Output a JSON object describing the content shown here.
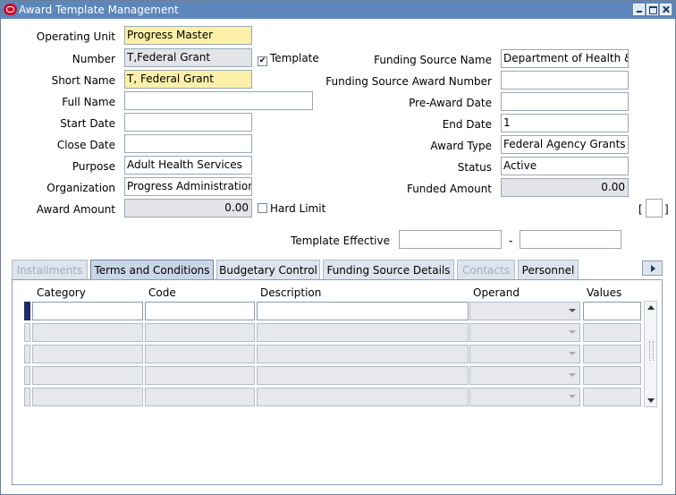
{
  "window": {
    "title": "Award Template Management"
  },
  "left": {
    "operating_unit": {
      "label": "Operating Unit",
      "value": "Progress Master"
    },
    "number": {
      "label": "Number",
      "value": "T,Federal Grant"
    },
    "template_checkbox": {
      "label": "Template",
      "checked_mark": "✔"
    },
    "short_name": {
      "label": "Short Name",
      "value": "T, Federal Grant"
    },
    "full_name": {
      "label": "Full Name",
      "value": ""
    },
    "start_date": {
      "label": "Start Date",
      "value": ""
    },
    "close_date": {
      "label": "Close Date",
      "value": ""
    },
    "purpose": {
      "label": "Purpose",
      "value": "Adult Health Services"
    },
    "organization": {
      "label": "Organization",
      "value": "Progress Administration"
    },
    "award_amount": {
      "label": "Award Amount",
      "value": "0.00"
    },
    "hard_limit": {
      "label": "Hard Limit"
    }
  },
  "right": {
    "funding_source_name": {
      "label": "Funding Source Name",
      "value": "Department of Health &"
    },
    "funding_source_award_number": {
      "label": "Funding Source Award Number",
      "value": ""
    },
    "pre_award_date": {
      "label": "Pre-Award Date",
      "value": ""
    },
    "end_date": {
      "label": "End Date",
      "value": "1"
    },
    "award_type": {
      "label": "Award Type",
      "value": "Federal Agency Grants"
    },
    "status": {
      "label": "Status",
      "value": "Active"
    },
    "funded_amount": {
      "label": "Funded Amount",
      "value": "0.00"
    },
    "bracket_left": "[",
    "bracket_right": "]"
  },
  "template_effective": {
    "label": "Template Effective",
    "from": "",
    "separator": "-",
    "to": ""
  },
  "tabs": [
    {
      "label": "Installments",
      "state": "disabled"
    },
    {
      "label": "Terms and Conditions",
      "state": "active"
    },
    {
      "label": "Budgetary Control",
      "state": "normal"
    },
    {
      "label": "Funding Source Details",
      "state": "normal"
    },
    {
      "label": "Contacts",
      "state": "disabled"
    },
    {
      "label": "Personnel",
      "state": "normal"
    }
  ],
  "table": {
    "columns": [
      "Category",
      "Code",
      "Description",
      "Operand",
      "Values"
    ],
    "rows": [
      {
        "category": "",
        "code": "",
        "description": "",
        "operand": "",
        "values": ""
      },
      {
        "category": "",
        "code": "",
        "description": "",
        "operand": "",
        "values": ""
      },
      {
        "category": "",
        "code": "",
        "description": "",
        "operand": "",
        "values": ""
      },
      {
        "category": "",
        "code": "",
        "description": "",
        "operand": "",
        "values": ""
      },
      {
        "category": "",
        "code": "",
        "description": "",
        "operand": "",
        "values": ""
      }
    ]
  },
  "icons": {
    "app": "oracle-logo-icon",
    "minimize": "minimize-icon",
    "maximize": "maximize-icon",
    "close": "close-icon",
    "tab_scroll": "tab-scroll-right-icon",
    "dropdown": "chevron-down-icon",
    "scroll_up": "scroll-up-icon",
    "scroll_down": "scroll-down-icon"
  },
  "colors": {
    "titlebar": "#5d86bb",
    "required_field": "#fcf0a8",
    "readonly_field": "#e3e4e8",
    "active_tab": "#c9d6e8",
    "row_indicator": "#1d2b66"
  }
}
